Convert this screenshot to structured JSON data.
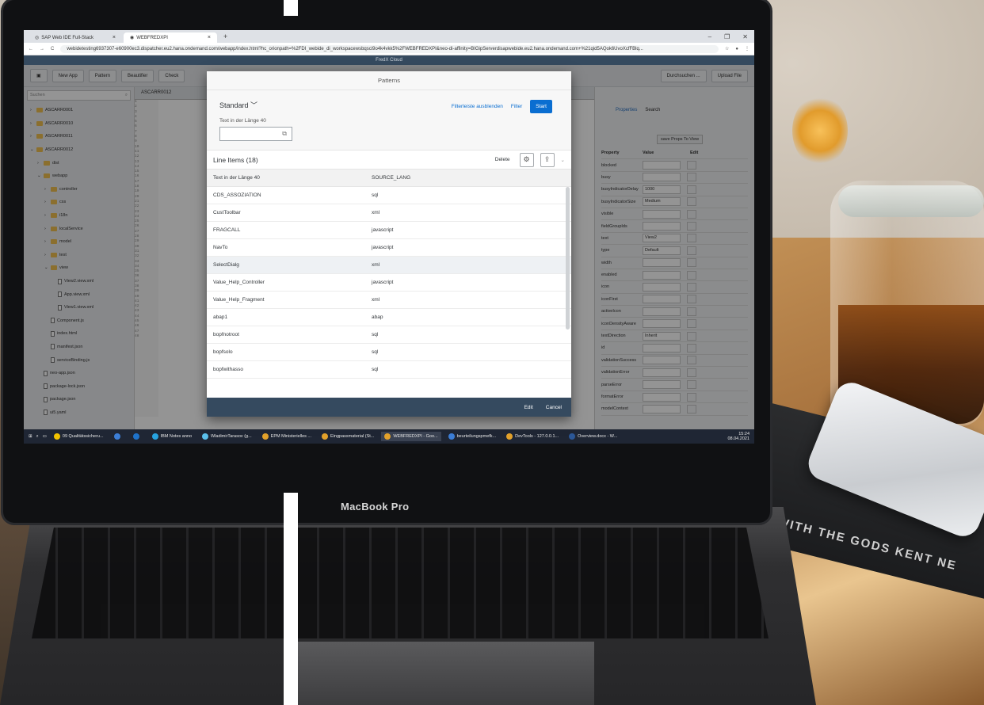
{
  "browser": {
    "tabs": [
      {
        "label": "SAP Web IDE Full-Stack",
        "active": false
      },
      {
        "label": "WEBFREDXPI",
        "active": true
      }
    ],
    "url": "webidetesting6937307-e60900ec3.dispatcher.eu2.hana.ondemand.com/webapp/index.html?hc_orionpath=%2FDI_webide_di_workspacewsbqsci9o4k4vkk5%2FWEBFREDXPI&neo-di-affinity=BIGipServerdisapwebide.eu2.hana.ondemand.com+%21qid5AQok6UvoXcfFBlq..."
  },
  "app": {
    "title": "FredX Cloud",
    "toolbar": [
      "New App",
      "Pattern",
      "Beautifier",
      "Check"
    ],
    "toolbar_right": [
      "Durchsuchen ...",
      "Upload File"
    ]
  },
  "tree": {
    "search_placeholder": "Suchen",
    "items": [
      {
        "label": "ASCARR0001",
        "type": "folder",
        "depth": 0
      },
      {
        "label": "ASCARR0010",
        "type": "folder",
        "depth": 0
      },
      {
        "label": "ASCARR0011",
        "type": "folder",
        "depth": 0
      },
      {
        "label": "ASCARR0012",
        "type": "folder",
        "depth": 0
      },
      {
        "label": "dist",
        "type": "folder",
        "depth": 1
      },
      {
        "label": "webapp",
        "type": "folder",
        "depth": 1
      },
      {
        "label": "controller",
        "type": "folder",
        "depth": 2
      },
      {
        "label": "css",
        "type": "folder",
        "depth": 2
      },
      {
        "label": "i18n",
        "type": "folder",
        "depth": 2
      },
      {
        "label": "localService",
        "type": "folder",
        "depth": 2
      },
      {
        "label": "model",
        "type": "folder",
        "depth": 2
      },
      {
        "label": "test",
        "type": "folder",
        "depth": 2
      },
      {
        "label": "view",
        "type": "folder",
        "depth": 2
      },
      {
        "label": "View2.view.xml",
        "type": "file",
        "depth": 3
      },
      {
        "label": "App.view.xml",
        "type": "file",
        "depth": 3
      },
      {
        "label": "View1.view.xml",
        "type": "file",
        "depth": 3
      },
      {
        "label": "Component.js",
        "type": "file",
        "depth": 2
      },
      {
        "label": "index.html",
        "type": "file",
        "depth": 2
      },
      {
        "label": "manifest.json",
        "type": "file",
        "depth": 2
      },
      {
        "label": "serviceBinding.js",
        "type": "file",
        "depth": 2
      },
      {
        "label": "neo-app.json",
        "type": "file",
        "depth": 1
      },
      {
        "label": "package-lock.json",
        "type": "file",
        "depth": 1
      },
      {
        "label": "package.json",
        "type": "file",
        "depth": 1
      },
      {
        "label": "ui5.yaml",
        "type": "file",
        "depth": 1
      }
    ]
  },
  "editor": {
    "tab_label": "ASCARR0012"
  },
  "properties": {
    "tabs": [
      "Properties",
      "Search"
    ],
    "save_label": "save Props To View",
    "headers": [
      "Property",
      "Value",
      "Edit"
    ],
    "rows": [
      {
        "name": "blocked",
        "value": ""
      },
      {
        "name": "busy",
        "value": ""
      },
      {
        "name": "busyIndicatorDelay",
        "value": "1000"
      },
      {
        "name": "busyIndicatorSize",
        "value": "Medium"
      },
      {
        "name": "visible",
        "value": ""
      },
      {
        "name": "fieldGroupIds",
        "value": ""
      },
      {
        "name": "text",
        "value": "View2"
      },
      {
        "name": "type",
        "value": "Default"
      },
      {
        "name": "width",
        "value": ""
      },
      {
        "name": "enabled",
        "value": ""
      },
      {
        "name": "icon",
        "value": ""
      },
      {
        "name": "iconFirst",
        "value": ""
      },
      {
        "name": "activeIcon",
        "value": ""
      },
      {
        "name": "iconDensityAware",
        "value": ""
      },
      {
        "name": "textDirection",
        "value": "Inherit"
      },
      {
        "name": "id",
        "value": ""
      },
      {
        "name": "validationSuccess",
        "value": ""
      },
      {
        "name": "validationError",
        "value": ""
      },
      {
        "name": "parseError",
        "value": ""
      },
      {
        "name": "formatError",
        "value": ""
      },
      {
        "name": "modelContext",
        "value": ""
      }
    ]
  },
  "dialog": {
    "title": "Patterns",
    "variant": "Standard",
    "filter_hide": "Filterleiste ausblenden",
    "filter": "Filter",
    "start": "Start",
    "field_label": "Text in der Länge 40",
    "list_title": "Line Items (18)",
    "delete": "Delete",
    "columns": [
      "Text in der Länge 40",
      "SOURCE_LANG"
    ],
    "rows": [
      [
        "CDS_ASSOZIATION",
        "sql"
      ],
      [
        "CustToolbar",
        "xml"
      ],
      [
        "FRAGCALL",
        "javascript"
      ],
      [
        "NavTo",
        "javascript"
      ],
      [
        "SelectDialg",
        "xml"
      ],
      [
        "Value_Help_Controller",
        "javascript"
      ],
      [
        "Value_Help_Fragment",
        "xml"
      ],
      [
        "abap1",
        "abap"
      ],
      [
        "bopfnotroot",
        "sql"
      ],
      [
        "bopfsolo",
        "sql"
      ],
      [
        "bopfwithasso",
        "sql"
      ]
    ],
    "selected_row": 4,
    "edit": "Edit",
    "cancel": "Cancel"
  },
  "taskbar": {
    "items": [
      {
        "label": "09 Qualitätssicheru...",
        "color": "#f2c200"
      },
      {
        "label": "",
        "color": "#3c7ed6"
      },
      {
        "label": "",
        "color": "#1e72c9"
      },
      {
        "label": "IBM Notes anno",
        "color": "#27a3e0"
      },
      {
        "label": "WladimirTarasov (g...",
        "color": "#5bc0eb"
      },
      {
        "label": "EPM Ministerielles ...",
        "color": "#e2a12b"
      },
      {
        "label": "Eingpassmaterial (St...",
        "color": "#e2a12b"
      },
      {
        "label": "WEBFREDXPI - Goo...",
        "color": "#e2a12b"
      },
      {
        "label": "beurteilungspmefk...",
        "color": "#3c7ed6"
      },
      {
        "label": "DevTools - 127.0.0.1...",
        "color": "#e2a12b"
      },
      {
        "label": "Overview.docx - W...",
        "color": "#2b5797"
      }
    ],
    "time": "15:24",
    "date": "08.04.2021"
  },
  "scene": {
    "laptop_brand": "MacBook Pro",
    "book_title": "WITH THE GODS  KENT NE"
  },
  "colors": {
    "sap_shell": "#354a5f",
    "sap_blue": "#0a6ed1",
    "taskbar": "#1f2634"
  }
}
